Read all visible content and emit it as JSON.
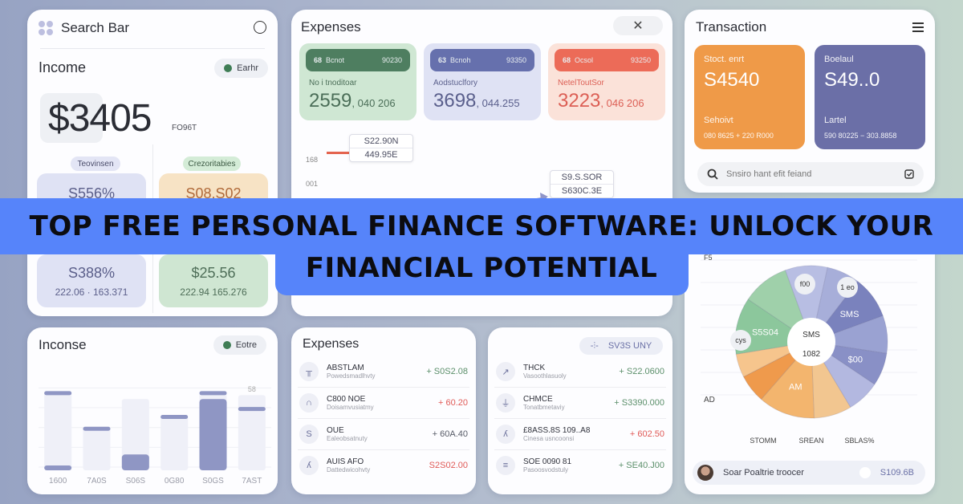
{
  "income_card": {
    "header_title": "Search Bar",
    "title": "Income",
    "status_pill": "Earhr",
    "amount": "$3405",
    "amount_suffix": "FO96T",
    "tag_left": "Teovinsen",
    "tag_right": "Crezoritabies",
    "tiles": [
      {
        "value": "S556%",
        "sub": ""
      },
      {
        "value": "S08.S02",
        "sub": ""
      },
      {
        "value": "S388%",
        "sub": "222.06 · 163.371"
      },
      {
        "value": "$25.56",
        "sub": "222.94 165.276"
      }
    ],
    "colors": {
      "status_dot": "#3f7d55",
      "tile_blue": "#dfe2f4",
      "tile_orange": "#f7e3c5",
      "tile_green": "#cfe6d2"
    }
  },
  "expenses_card": {
    "title": "Expenses",
    "close_icon": "close-icon",
    "tiles": [
      {
        "header_icon": "68",
        "header_label": "Bcnot",
        "header_value": "90230",
        "label": "No i tnoditoar",
        "value": "2559",
        "value_suffix": ", 040 206",
        "bg": "#cfe7d3",
        "header_bg": "#4e7e60",
        "text_color": "#4b6e58"
      },
      {
        "header_icon": "63",
        "header_label": "Bcnoh",
        "header_value": "93350",
        "label": "Aodstuclfory",
        "value": "3698",
        "value_suffix": ", 044.255",
        "bg": "#dfe2f4",
        "header_bg": "#6670ad",
        "text_color": "#5a5f8c"
      },
      {
        "header_icon": "68",
        "header_label": "Ocsol",
        "header_value": "93250",
        "label": "NetelToutSor",
        "value": "3223",
        "value_suffix": ", 046 206",
        "bg": "#fbe2d9",
        "header_bg": "#ec6b58",
        "text_color": "#dc5f55"
      }
    ],
    "axis_labels": [
      "168",
      "001"
    ],
    "callouts": [
      {
        "line1": "S22.90N",
        "line2": "449.95E"
      },
      {
        "line1": "S9.S.SOR",
        "line2": "S630C.3E"
      }
    ]
  },
  "transaction_card": {
    "title": "Transaction",
    "menu_icon": "hamburger-icon",
    "tiles": [
      {
        "label": "Stoct. enrt",
        "amount": "S4540",
        "label2": "Sehoivt",
        "detail": "080 8625 + 220 R000",
        "bg": "#ef9a48"
      },
      {
        "label": "Boelaul",
        "amount": "S49..0",
        "label2": "Lartel",
        "detail": "590 80225 − 303.8858",
        "bg": "#6b6fa7"
      }
    ],
    "search_placeholder": "Snsiro hant efit feiand"
  },
  "incomse_card": {
    "title": "Inconse",
    "status_pill": "Eotre",
    "chart_data": {
      "type": "bar",
      "categories": [
        "1600",
        "7A0S",
        "S06S",
        "0G80",
        "S0GS",
        "7AST"
      ],
      "values": [
        0.3,
        0.55,
        0.2,
        0.7,
        0.9,
        0.8
      ],
      "max_values": [
        1.0,
        0.55,
        0.9,
        0.7,
        1.0,
        0.95
      ],
      "top_marker": [
        1.0,
        0.55,
        null,
        0.7,
        1.0,
        0.8
      ],
      "annotation": "58"
    }
  },
  "expenses_list": {
    "title": "Expenses",
    "rows": [
      {
        "icon": "building-icon",
        "glyph": "╥",
        "title": "ABSTLAM",
        "sub": "Powedsmadlhvty",
        "amount": "+ S0S2.08",
        "color": "#5b8f6a"
      },
      {
        "icon": "bag-icon",
        "glyph": "∩",
        "title": "C800 NOE",
        "sub": "Doisamvusiatmy",
        "amount": "+ 60.20",
        "color": "#e05a57"
      },
      {
        "icon": "dollar-icon",
        "glyph": "S",
        "title": "OUE",
        "sub": "Ealeobsatnuty",
        "amount": "+ 60A.40",
        "color": "#565a66"
      },
      {
        "icon": "person-icon",
        "glyph": "ʎ",
        "title": "AUIS AFO",
        "sub": "Dattedwicohvty",
        "amount": "S2S02.00",
        "color": "#e05a57"
      }
    ]
  },
  "transactions_list": {
    "filter_label": "SV3S UNY",
    "filter_icon": "filter-icon",
    "rows": [
      {
        "icon": "trend-icon",
        "glyph": "↗",
        "title": "THCK",
        "sub": "Vasoothlasuoly",
        "amount": "+ S22.0600",
        "color": "#5b8f6a"
      },
      {
        "icon": "bank-icon",
        "glyph": "⏚",
        "title": "CHMCE",
        "sub": "Tonatbmetaviy",
        "amount": "+ S3390.000",
        "color": "#5b8f6a"
      },
      {
        "icon": "walk-icon",
        "glyph": "ʎ",
        "title": "£8ASS.8S 109..A8",
        "sub": "Cinesa usncoonsi",
        "amount": "+ 602.50",
        "color": "#e05a57"
      },
      {
        "icon": "menu-list-icon",
        "glyph": "≡",
        "title": "SOE 0090 81",
        "sub": "Pasoosvodstuly",
        "amount": "+ SE40.J00",
        "color": "#5b8f6a"
      }
    ]
  },
  "pie_card": {
    "corner_label": "F5",
    "left_label": "AD",
    "center_top": "SMS",
    "center_bottom": "1082",
    "bubble_labels": [
      "f00",
      "1 eo",
      "cys"
    ],
    "chart_data": {
      "type": "pie",
      "slices": [
        {
          "label": "f00",
          "value": 9,
          "color": "#b8bee3"
        },
        {
          "label": "",
          "value": 7,
          "color": "#a7aed9"
        },
        {
          "label": "SMS",
          "value": 9,
          "color": "#7a82bd"
        },
        {
          "label": "",
          "value": 8,
          "color": "#9aa2d2"
        },
        {
          "label": "$00",
          "value": 7,
          "color": "#8990c6"
        },
        {
          "label": "",
          "value": 7,
          "color": "#b3b8e0"
        },
        {
          "label": "",
          "value": 8,
          "color": "#f2c690"
        },
        {
          "label": "AM",
          "value": 12,
          "color": "#f3b56e"
        },
        {
          "label": "",
          "value": 6,
          "color": "#ef9a4c"
        },
        {
          "label": "",
          "value": 5,
          "color": "#f6c58d"
        },
        {
          "label": "S5S04",
          "value": 12,
          "color": "#8cc79c"
        },
        {
          "label": "1 eo",
          "value": 10,
          "color": "#9fd0aa"
        }
      ],
      "legend": [
        "STOMM",
        "SREAN",
        "SBLAS%"
      ]
    },
    "profile_name": "Soar Poaltrie troocer",
    "profile_value": "S109.6B"
  },
  "banner": {
    "line1": "TOP FREE PERSONAL FINANCE SOFTWARE: UNLOCK YOUR",
    "line2": "FINANCIAL POTENTIAL",
    "bg": "#5684fa"
  }
}
